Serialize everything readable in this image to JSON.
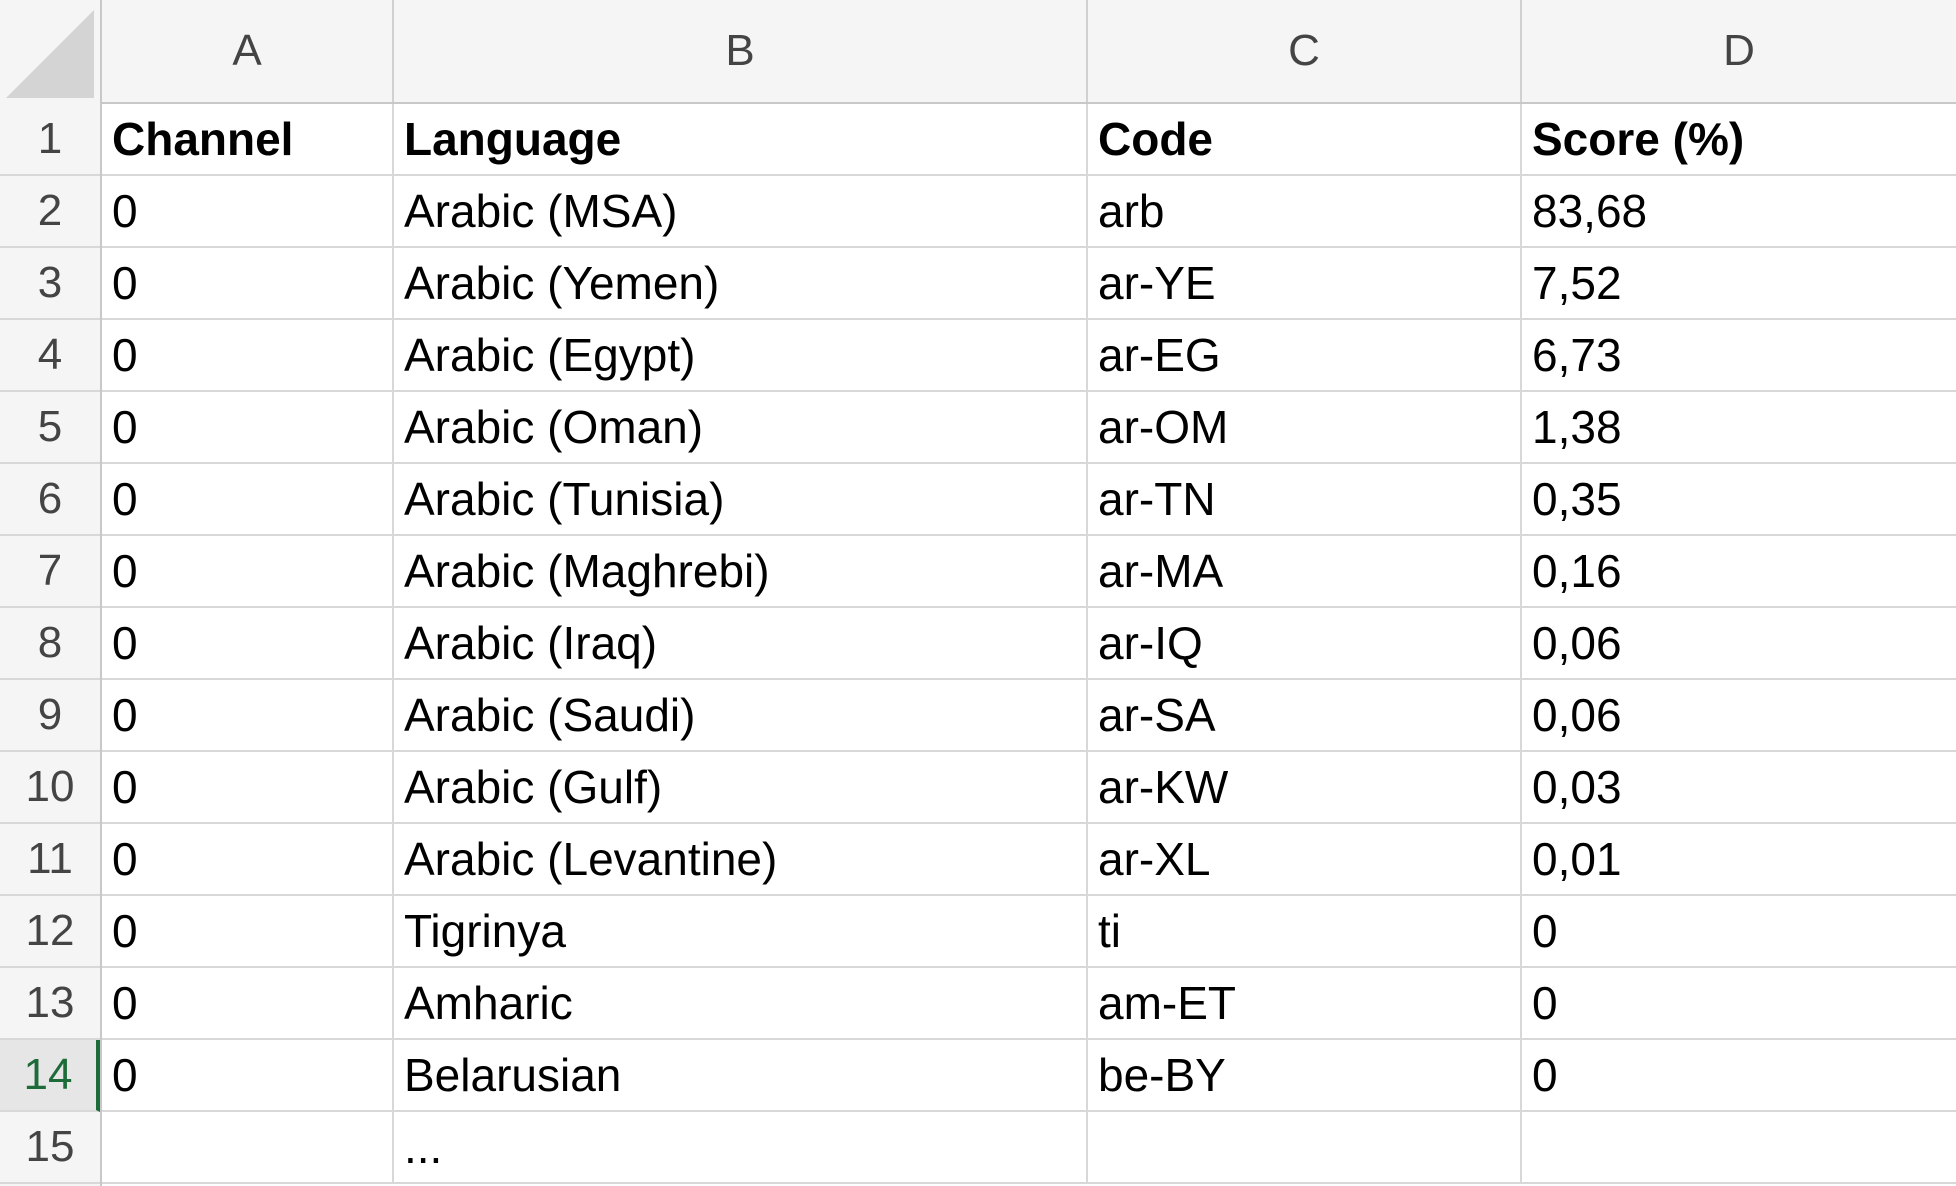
{
  "columns": [
    "A",
    "B",
    "C",
    "D"
  ],
  "rows": [
    {
      "num": "1",
      "cells": [
        "Channel",
        "Language",
        "Code",
        "Score (%)"
      ],
      "header": true
    },
    {
      "num": "2",
      "cells": [
        "0",
        "Arabic (MSA)",
        "arb",
        "83,68"
      ]
    },
    {
      "num": "3",
      "cells": [
        "0",
        "Arabic (Yemen)",
        "ar-YE",
        "7,52"
      ]
    },
    {
      "num": "4",
      "cells": [
        "0",
        "Arabic (Egypt)",
        "ar-EG",
        "6,73"
      ]
    },
    {
      "num": "5",
      "cells": [
        "0",
        "Arabic (Oman)",
        "ar-OM",
        "1,38"
      ]
    },
    {
      "num": "6",
      "cells": [
        "0",
        "Arabic (Tunisia)",
        "ar-TN",
        "0,35"
      ]
    },
    {
      "num": "7",
      "cells": [
        "0",
        "Arabic (Maghrebi)",
        "ar-MA",
        "0,16"
      ]
    },
    {
      "num": "8",
      "cells": [
        "0",
        "Arabic (Iraq)",
        "ar-IQ",
        "0,06"
      ]
    },
    {
      "num": "9",
      "cells": [
        "0",
        "Arabic (Saudi)",
        "ar-SA",
        "0,06"
      ]
    },
    {
      "num": "10",
      "cells": [
        "0",
        "Arabic (Gulf)",
        "ar-KW",
        "0,03"
      ]
    },
    {
      "num": "11",
      "cells": [
        "0",
        "Arabic (Levantine)",
        "ar-XL",
        "0,01"
      ]
    },
    {
      "num": "12",
      "cells": [
        "0",
        "Tigrinya",
        "ti",
        "0"
      ]
    },
    {
      "num": "13",
      "cells": [
        "0",
        "Amharic",
        "am-ET",
        "0"
      ]
    },
    {
      "num": "14",
      "cells": [
        "0",
        "Belarusian",
        "be-BY",
        "0"
      ],
      "active": true
    },
    {
      "num": "15",
      "cells": [
        "",
        "...",
        "",
        ""
      ]
    }
  ]
}
